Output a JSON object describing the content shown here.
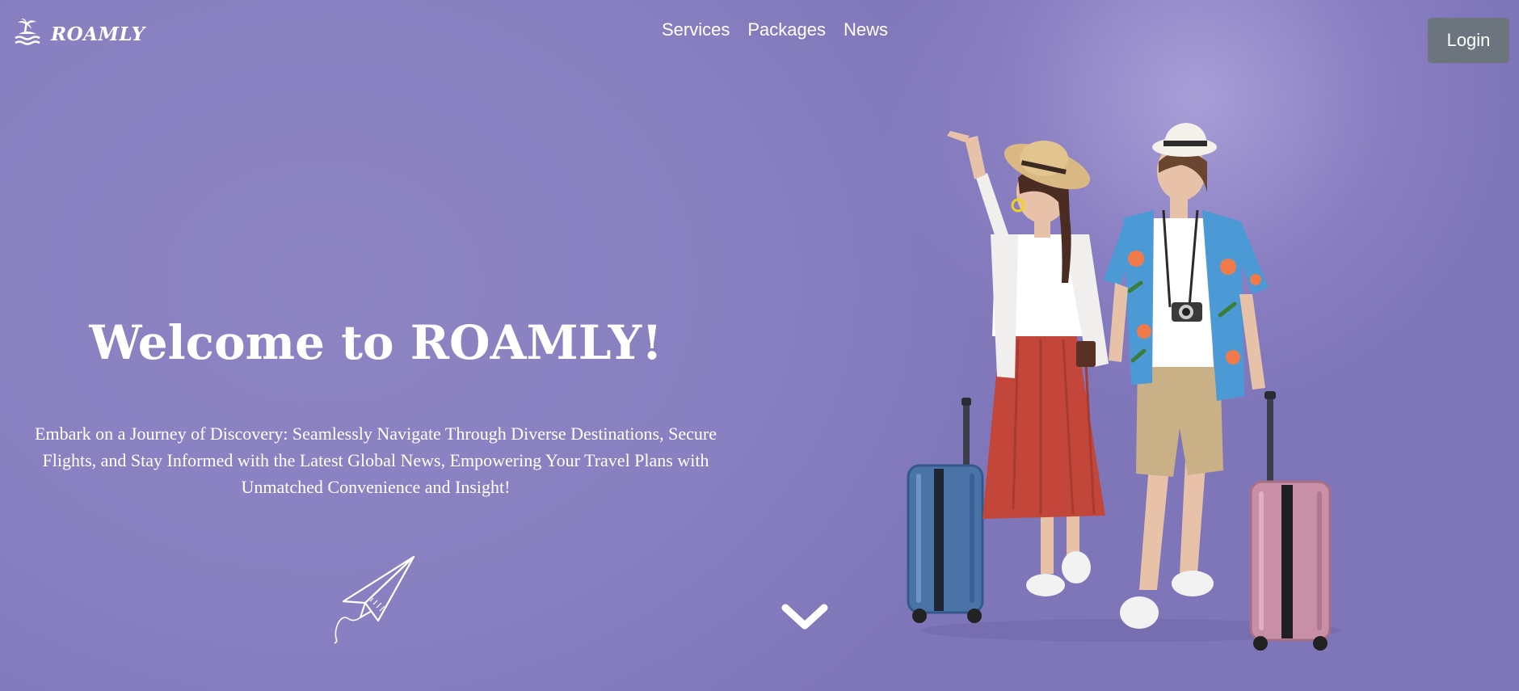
{
  "brand": {
    "name": "ROAMLY",
    "logo_icon": "palm-island-icon"
  },
  "nav": {
    "items": [
      {
        "label": "Services"
      },
      {
        "label": "Packages"
      },
      {
        "label": "News"
      }
    ],
    "login_label": "Login"
  },
  "hero": {
    "title": "Welcome to ROAMLY!",
    "subtitle": "Embark on a Journey of Discovery: Seamlessly Navigate Through Diverse Destinations, Secure Flights, and Stay Informed with the Latest Global News, Empowering Your Travel Plans with Unmatched Convenience and Insight!",
    "plane_icon": "paper-plane-icon",
    "scroll_icon": "chevron-down-icon",
    "image": "travel-couple-with-luggage"
  },
  "colors": {
    "background": "#8a81c2",
    "button": "#6c757d",
    "text": "#ffffff"
  }
}
